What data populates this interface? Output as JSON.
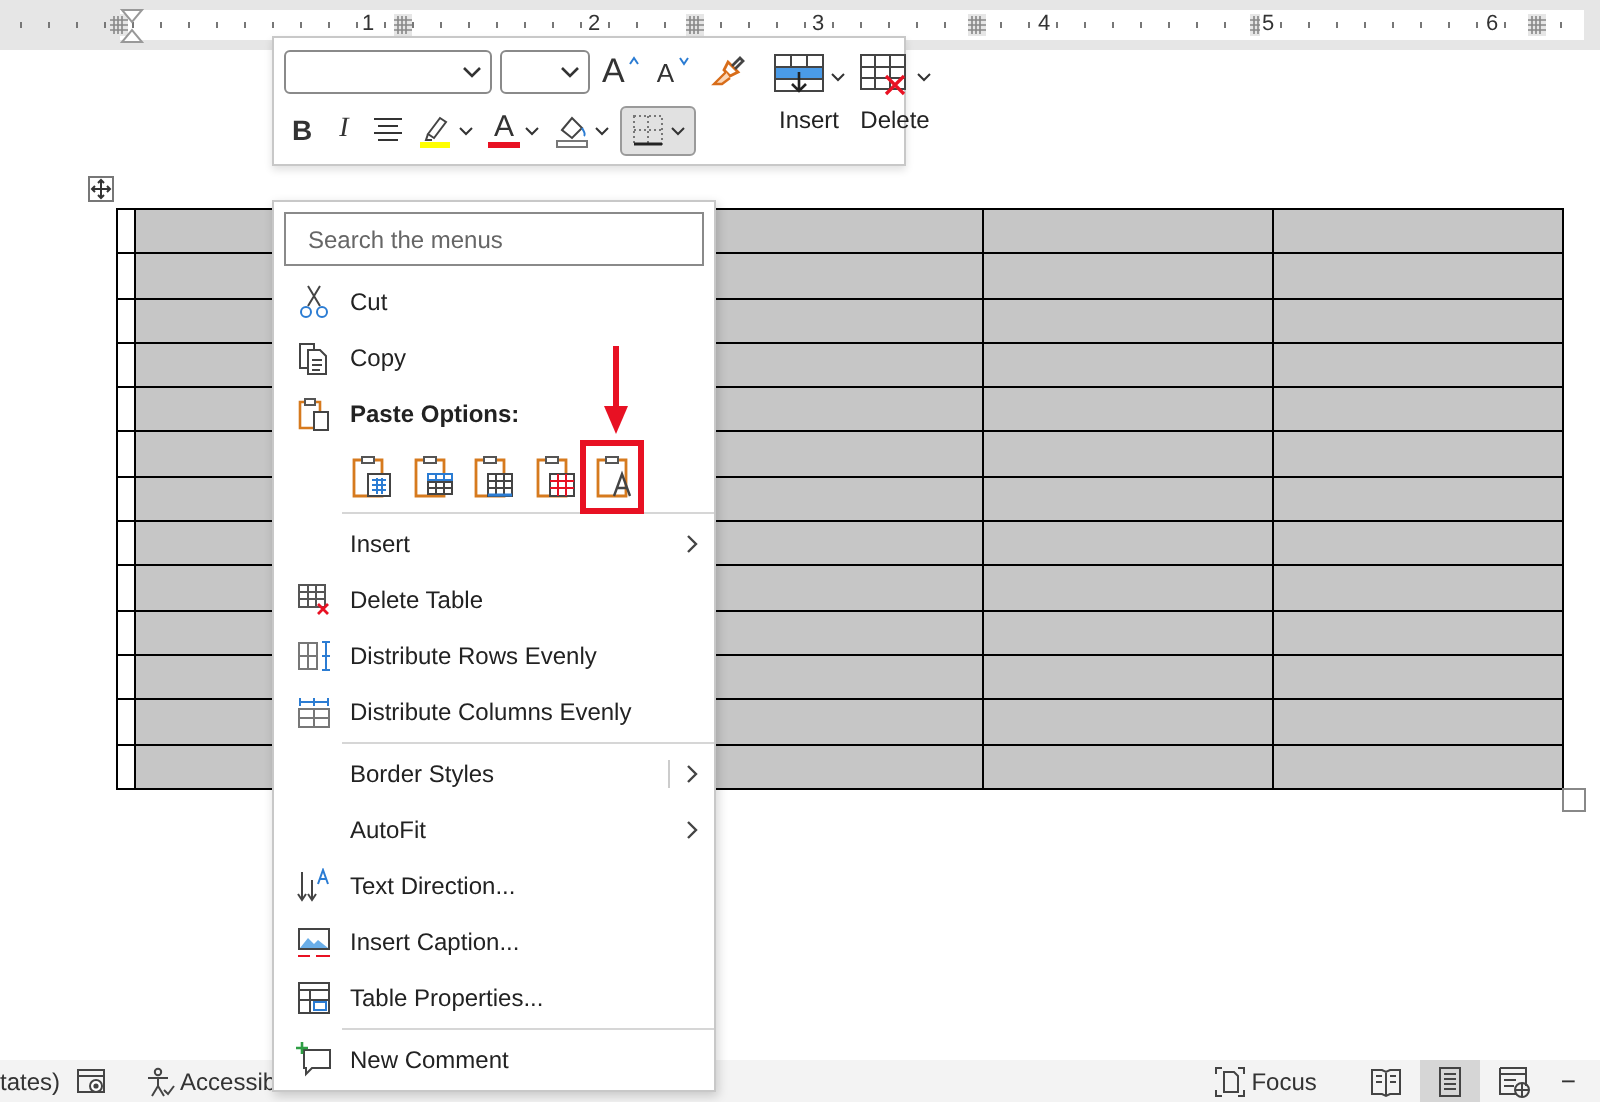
{
  "ruler": {
    "labels": [
      "1",
      "2",
      "3",
      "4",
      "5",
      "6"
    ]
  },
  "mini_toolbar": {
    "row1": [
      {
        "kind": "grow",
        "label": "A"
      },
      {
        "kind": "shrink",
        "label": "A"
      },
      {
        "kind": "painter"
      }
    ],
    "row2": [
      {
        "kind": "bold",
        "label": "B",
        "selected": false
      },
      {
        "kind": "italic",
        "label": "I",
        "selected": false
      },
      {
        "kind": "align",
        "selected": false
      },
      {
        "kind": "highlight",
        "color": "#ffff00",
        "selected": false
      },
      {
        "kind": "fontcolor",
        "label": "A",
        "color": "#e81123",
        "selected": false
      },
      {
        "kind": "shading",
        "selected": false
      },
      {
        "kind": "borders",
        "selected": true
      }
    ],
    "table_buttons": [
      {
        "kind": "insert",
        "label": "Insert"
      },
      {
        "kind": "delete",
        "label": "Delete"
      }
    ]
  },
  "context_menu": {
    "search": {
      "placeholder": "Search the menus"
    },
    "items": [
      {
        "kind": "command",
        "label": "Cut"
      },
      {
        "kind": "command",
        "label": "Copy"
      },
      {
        "kind": "heading",
        "label": "Paste Options:"
      },
      {
        "kind": "paste",
        "options": [
          {
            "highlighted": false
          },
          {
            "highlighted": false
          },
          {
            "highlighted": false
          },
          {
            "highlighted": false
          },
          {
            "highlighted": true
          }
        ]
      },
      {
        "kind": "separator"
      },
      {
        "kind": "command",
        "label": "Insert",
        "submenu": true
      },
      {
        "kind": "command",
        "label": "Delete Table"
      },
      {
        "kind": "command",
        "label": "Distribute Rows Evenly"
      },
      {
        "kind": "command",
        "label": "Distribute Columns Evenly"
      },
      {
        "kind": "separator"
      },
      {
        "kind": "command",
        "label": "Border Styles",
        "submenu": true,
        "split": true
      },
      {
        "kind": "command",
        "label": "AutoFit",
        "submenu": true
      },
      {
        "kind": "command",
        "label": "Text Direction..."
      },
      {
        "kind": "command",
        "label": "Insert Caption..."
      },
      {
        "kind": "command",
        "label": "Table Properties..."
      },
      {
        "kind": "separator"
      },
      {
        "kind": "command",
        "label": "New Comment"
      }
    ]
  },
  "status_bar": {
    "language": "tates)",
    "accessibility": "Accessib",
    "focus": "Focus",
    "views": [
      {
        "selected": false
      },
      {
        "selected": true
      },
      {
        "selected": false
      }
    ],
    "zoom_out": "−"
  }
}
